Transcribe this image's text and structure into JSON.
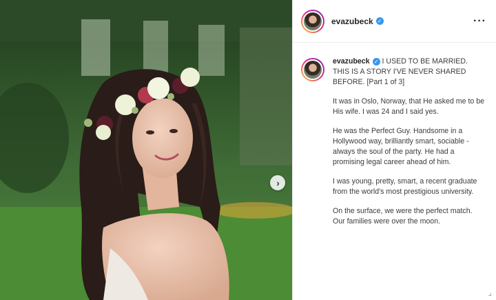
{
  "post": {
    "username": "evazubeck",
    "verified_icon": "verified-check-icon",
    "more_icon": "ellipsis-icon",
    "next_icon": "chevron-right-icon",
    "caption_lines": [
      "I USED TO BE MARRIED. THIS IS A STORY I'VE NEVER SHARED BEFORE. [Part 1 of 3]",
      "It was in Oslo, Norway, that He asked me to be His wife. I was 24 and I said yes.",
      "He was the Perfect Guy. Handsome in a Hollywood way, brilliantly smart, sociable - always the soul of the party. He had a promising legal career ahead of him.",
      "I was young, pretty, smart, a recent graduate from the world's most prestigious university.",
      "On the surface, we were the perfect match. Our families were over the moon."
    ]
  }
}
